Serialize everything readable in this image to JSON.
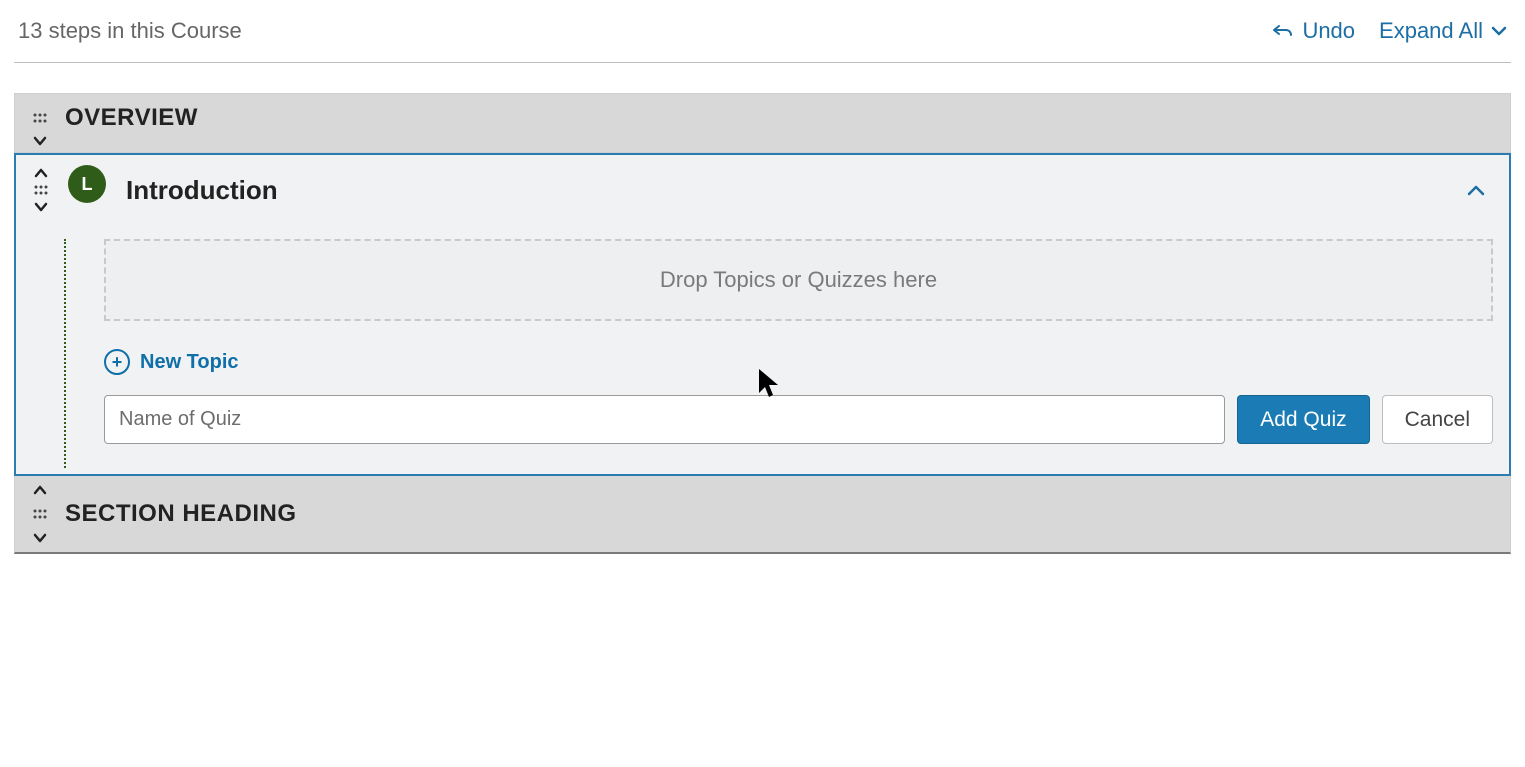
{
  "topbar": {
    "steps_text": "13 steps in this Course",
    "undo_label": "Undo",
    "expand_label": "Expand All"
  },
  "overview": {
    "title": "OVERVIEW"
  },
  "introduction": {
    "badge_letter": "L",
    "title": "Introduction",
    "dropzone_text": "Drop Topics or Quizzes here",
    "new_topic_label": "New Topic",
    "quiz_input_placeholder": "Name of Quiz",
    "add_quiz_label": "Add Quiz",
    "cancel_label": "Cancel"
  },
  "section_heading": {
    "title": "SECTION HEADING"
  }
}
